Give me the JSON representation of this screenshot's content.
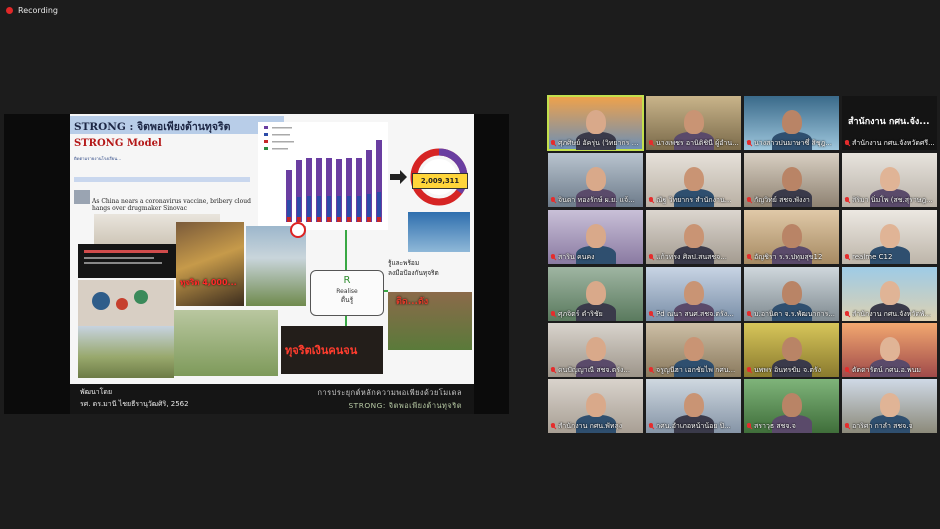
{
  "recording": {
    "label": "Recording",
    "dot_color": "#e02828"
  },
  "share": {
    "slide": {
      "title": "STRONG : จิตพอเพียงต้านทุจริต",
      "model": "STRONG  Model",
      "subtitle": "ติดตามรายงานโรงเรียน...",
      "news_headline": "As China nears a coronavirus vaccine, bribery cloud hangs over drugmaker Sinovac",
      "donut_value": "2,009,311",
      "r_letter": "R",
      "r_english": "Realise",
      "r_thai": "ตื่นรู้",
      "ready_text_1": "รู้และพร้อม",
      "ready_text_2": "ลงมือป้องกันทุจริต",
      "bottom_banner": "ทุจริตเงินคนจน",
      "photo_caption": "ทุจริต 4,000..."
    },
    "footer": {
      "left_line1": "พัฒนาโดย",
      "left_line2": "รศ. ดร.มานี ไชยธีรานุวัฒศิริ, 2562",
      "right_line1": "การประยุกต์หลักความพอเพียงด้วยโมเดล",
      "right_line2": "STRONG: จิตพอเพียงต้านทุจริต"
    }
  },
  "gallery": [
    {
      "name": "ศุภศิษย์ อัครุ่น (วิทยากร ป...",
      "muted": true,
      "active": true
    },
    {
      "name": "นางเพชร อานิติชินี ผู้อำน...",
      "muted": true
    },
    {
      "name": "นางสาวปนมาษาซึ่ สิชุฎ...",
      "muted": true
    },
    {
      "name": "สำนักงาน กศน.จังหวัดศรี...",
      "muted": true,
      "big_text": "สำนักงาน กศน.จัง..."
    },
    {
      "name": "จินดา ทองรักษ์ ผ.ย. แจ้...",
      "muted": true
    },
    {
      "name": "ณัฐ วิทยากร สำนักงาน...",
      "muted": true
    },
    {
      "name": "กัญวิทย์ สชจ.พังงา",
      "muted": true
    },
    {
      "name": "สิริมา นิ่มโพ (สช.สุราษฎ...",
      "muted": true
    },
    {
      "name": "สาริน คนคง",
      "muted": true
    },
    {
      "name": "แก้วทรง ศิลป.สนสชจ...",
      "muted": true
    },
    {
      "name": "อัญชิรา ร.ร.ปทุมสุข12",
      "muted": true
    },
    {
      "name": "realme C12",
      "muted": true
    },
    {
      "name": "ศุภจิตร์ ดำริชัย",
      "muted": true
    },
    {
      "name": "Pd ณนา สนศ.สชจ.ตรัง...",
      "muted": true
    },
    {
      "name": "ม.อานิตา จ.ร.พัฒนาการ...",
      "muted": true
    },
    {
      "name": "สำนักงาน กศน.จังหวัดพั...",
      "muted": true
    },
    {
      "name": "ดนปัญญาณี สชจ.ตรัง...",
      "muted": true
    },
    {
      "name": "จรูญนีฮา เอกชัยไพ กศน...",
      "muted": true
    },
    {
      "name": "นพพร อินทรขัม จ.ตรัง",
      "muted": true
    },
    {
      "name": "ดัดดารัตน์ กศน.อ.พนม",
      "muted": true
    },
    {
      "name": "สำนักงาน กศน.พัทลุง",
      "muted": true
    },
    {
      "name": "กศน.อำเภอหน้าน้อย ปิ...",
      "muted": true
    },
    {
      "name": "สราวุธ สชจ.จ",
      "muted": true
    },
    {
      "name": "อาริศา กาลำ สชจ.จ",
      "muted": true
    }
  ]
}
